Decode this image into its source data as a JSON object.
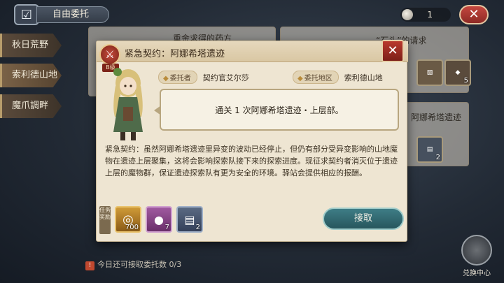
{
  "top_bar": {
    "title": "自由委托",
    "coin_count": "1",
    "close_symbol": "✕"
  },
  "sidebar": {
    "items": [
      {
        "label": "秋日荒野"
      },
      {
        "label": "索利德山地"
      },
      {
        "label": "魔爪調畔"
      }
    ]
  },
  "background": {
    "card1_title": "重金求得的药方",
    "card2_title": "“石头”的请求",
    "card3_title": "阿娜希塔遗迹",
    "card2_item_counts": [
      "5"
    ],
    "card3_item_counts": [
      "2"
    ]
  },
  "modal": {
    "title": "紧急契约：阿娜希塔遗迹",
    "rank": "B级",
    "client_label": "委托者",
    "client_value": "契约官艾尔莎",
    "region_label": "委托地区",
    "region_value": "索利德山地",
    "objective": "通关 1 次阿娜希塔遗迹・上层部。",
    "description": "紧急契约：虽然阿娜希塔遗迹里异变的波动已经停止，但仍有部分受异变影响的山地魔物在遗迹上层聚集，这将会影响探索队接下来的探索进度。现征求契约者消灭位于遗迹上层的魔物群，保证遗迹探索队有更为安全的环境。驿站会提供相应的报酬。",
    "reward_label": "任务奖励",
    "rewards": [
      {
        "name": "silver-coin",
        "count": "700"
      },
      {
        "name": "bread",
        "count": "7"
      },
      {
        "name": "stone-tablet",
        "count": "2"
      }
    ],
    "accept_label": "接取",
    "close_symbol": "✕"
  },
  "footer": {
    "note_prefix": "今日还可接取委托数",
    "note_count": "0/3"
  },
  "exchange": {
    "label": "兑换中心"
  },
  "colors": {
    "accent_red": "#b9382d",
    "accept_teal": "#3e7d86",
    "panel": "#eee5d2"
  }
}
